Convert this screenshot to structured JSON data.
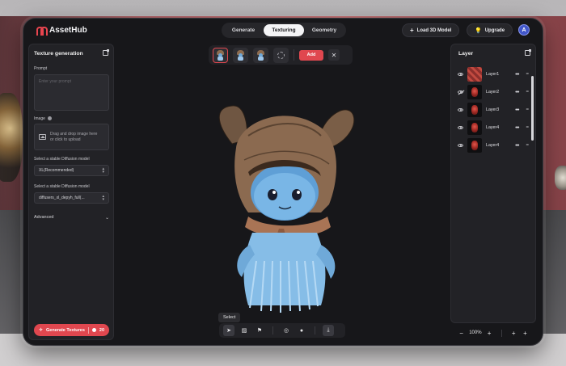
{
  "app": {
    "name": "AssetHub"
  },
  "nav_tabs": [
    {
      "label": "Generate"
    },
    {
      "label": "Texturing"
    },
    {
      "label": "Geometry"
    }
  ],
  "active_tab": "Texturing",
  "header": {
    "load_model_label": "Load 3D Model",
    "upgrade_label": "Upgrade",
    "avatar_initial": "A"
  },
  "left_panel": {
    "title": "Texture generation",
    "prompt_label": "Prompt",
    "prompt_placeholder": "Enter your prompt",
    "image_label": "Image",
    "upload_text_line1": "Drag and drop image here",
    "upload_text_line2": "or click to upload",
    "model_label_1": "Select a stable Diffusion model",
    "model_value_1": "XL(Recommended)",
    "model_label_2": "Select a stable Diffusion model",
    "model_value_2": "diffusers_xl_depyh_full(...",
    "advanced_label": "Advanced",
    "generate_button_label": "Generate Textures",
    "credits_cost": "20"
  },
  "toolbar": {
    "add_label": "Add",
    "select_tooltip": "Select"
  },
  "layers_panel": {
    "title": "Layer",
    "layers": [
      {
        "name": "Layer1",
        "visible": true
      },
      {
        "name": "Layer2",
        "visible": false
      },
      {
        "name": "Layer3",
        "visible": true
      },
      {
        "name": "Layer4",
        "visible": true
      },
      {
        "name": "Layer4",
        "visible": true
      }
    ]
  },
  "zoom": {
    "level": "100%"
  },
  "colors": {
    "accent": "#e0474f",
    "panel": "#222226",
    "background": "#17171a",
    "avatar": "#4257c9"
  }
}
